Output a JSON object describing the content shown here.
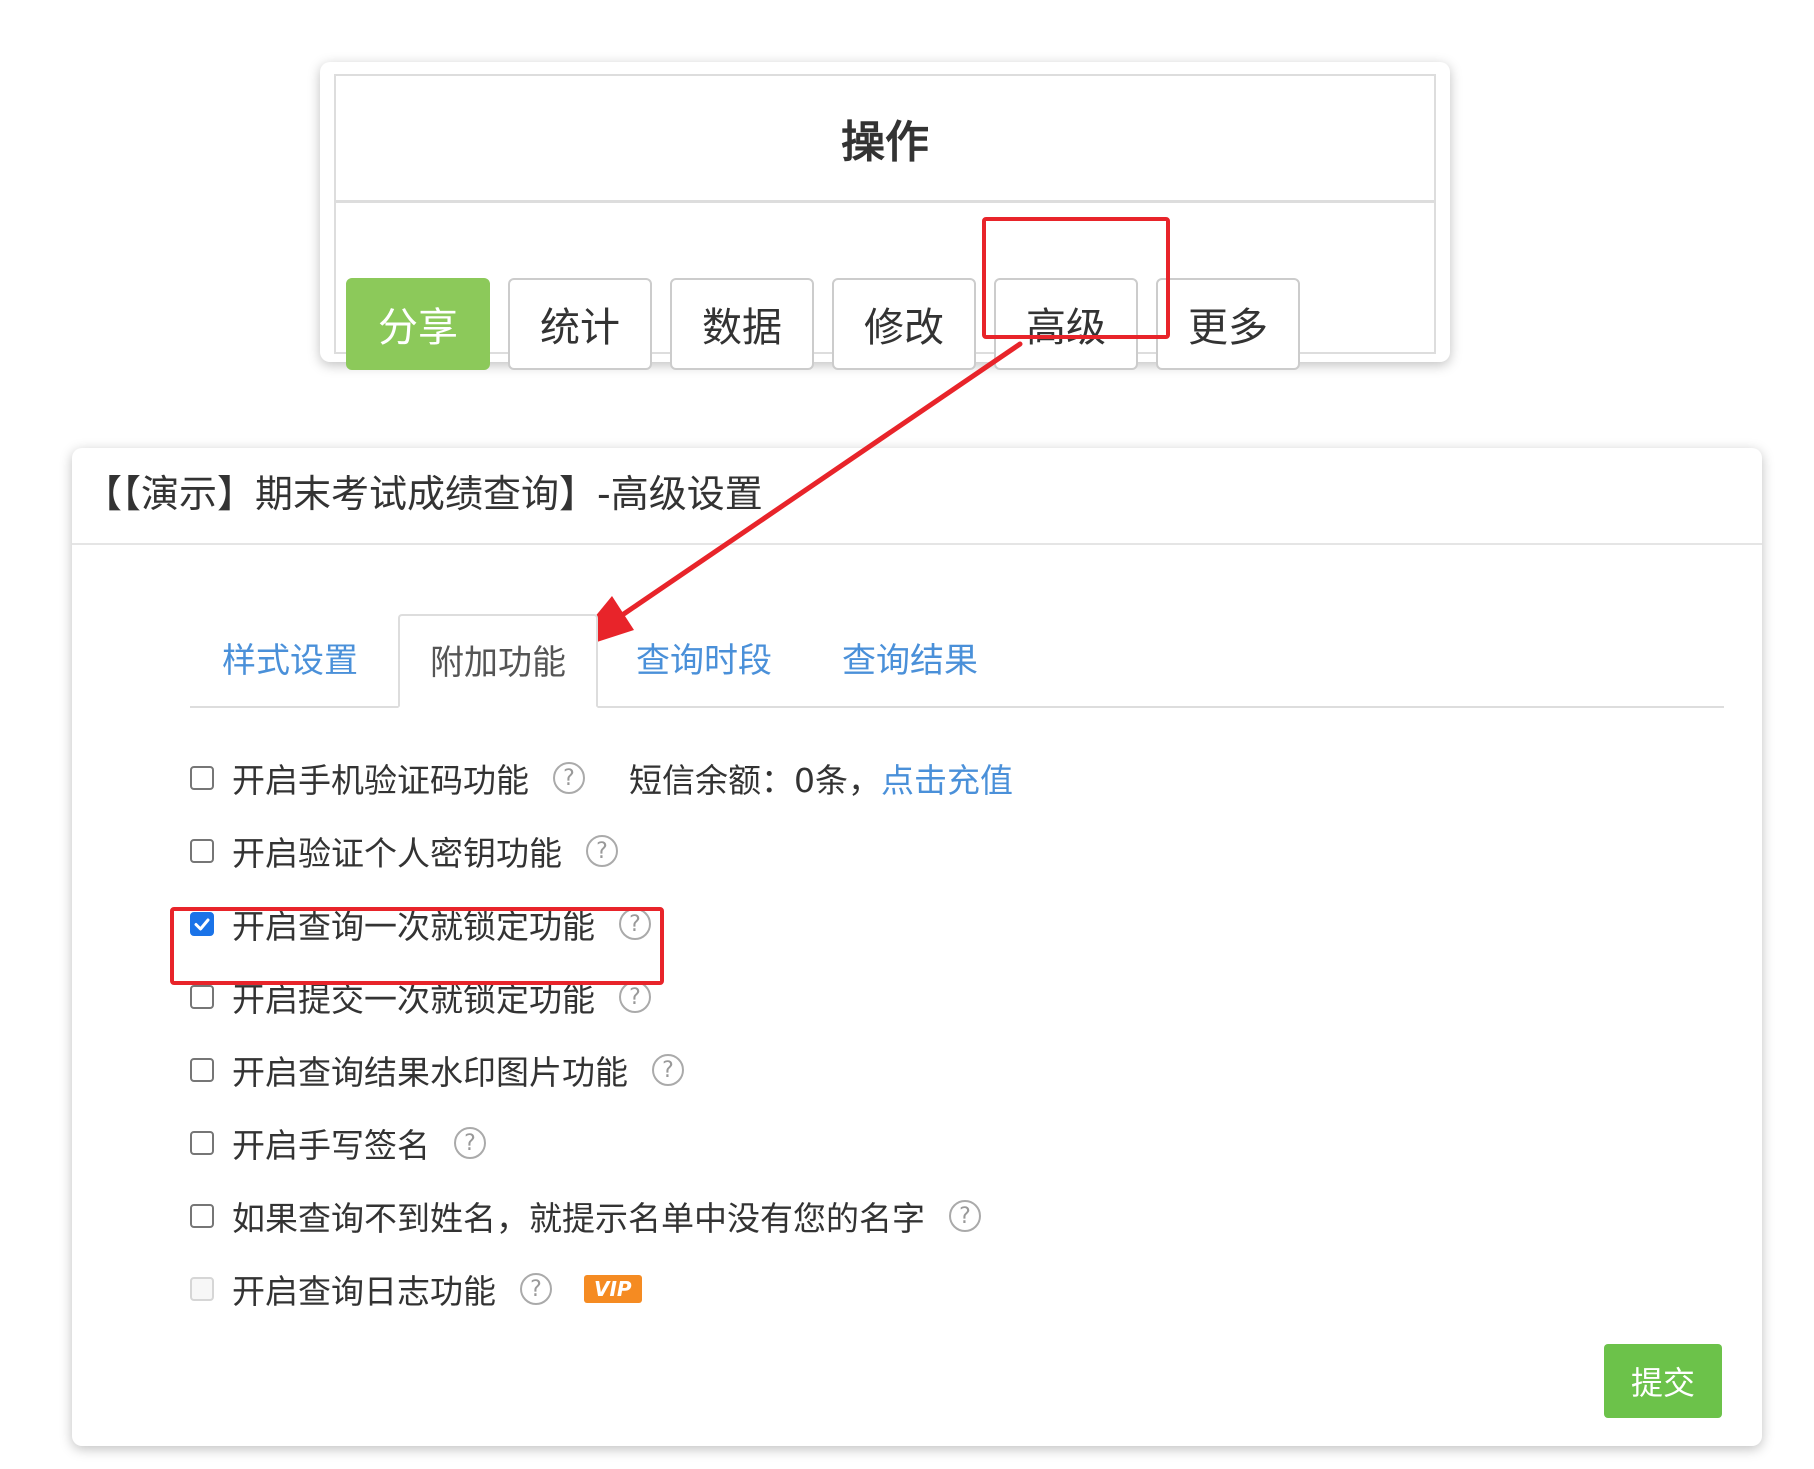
{
  "ops": {
    "header": "操作",
    "buttons": [
      {
        "label": "分享"
      },
      {
        "label": "统计"
      },
      {
        "label": "数据"
      },
      {
        "label": "修改"
      },
      {
        "label": "高级"
      },
      {
        "label": "更多"
      }
    ]
  },
  "panel": {
    "title": "【【演示】期末考试成绩查询】-高级设置",
    "tabs": [
      {
        "label": "样式设置"
      },
      {
        "label": "附加功能"
      },
      {
        "label": "查询时段"
      },
      {
        "label": "查询结果"
      }
    ],
    "active_tab": "附加功能",
    "options": [
      {
        "label": "开启手机验证码功能",
        "checked": false
      },
      {
        "label": "开启验证个人密钥功能",
        "checked": false
      },
      {
        "label": "开启查询一次就锁定功能",
        "checked": true
      },
      {
        "label": "开启提交一次就锁定功能",
        "checked": false
      },
      {
        "label": "开启查询结果水印图片功能",
        "checked": false
      },
      {
        "label": "开启手写签名",
        "checked": false
      },
      {
        "label": "如果查询不到姓名，就提示名单中没有您的名字",
        "checked": false
      },
      {
        "label": "开启查询日志功能",
        "checked": false,
        "disabled": true
      }
    ],
    "sms": {
      "balance_text": "短信余额：0条，",
      "recharge_label": "点击充值"
    },
    "help_glyph": "?",
    "vip_label": "VIP",
    "submit_label": "提交"
  },
  "colors": {
    "share_green": "#8cc95a",
    "submit_green": "#6cc24a",
    "link_blue": "#4a90d9",
    "highlight_red": "#e8242a",
    "vip_orange": "#f58b22",
    "checkbox_blue": "#1a73e8"
  },
  "icons": {
    "help": "help-circle-icon",
    "check": "checkmark-icon",
    "arrow": "annotation-arrow"
  }
}
